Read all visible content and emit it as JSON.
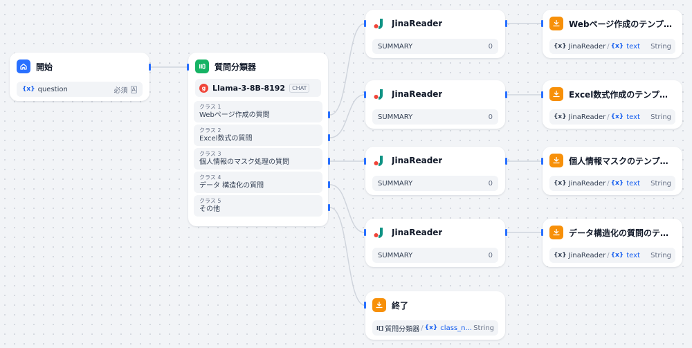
{
  "start": {
    "title": "開始",
    "var_name": "question",
    "var_required": "必須",
    "var_type_glyph": "A"
  },
  "classifier": {
    "title": "質問分類器",
    "model": "Llama-3-8B-8192",
    "model_tag": "CHAT",
    "classes": [
      {
        "label": "クラス 1",
        "text": "Webページ作成の質問"
      },
      {
        "label": "クラス 2",
        "text": "Excel数式の質問"
      },
      {
        "label": "クラス 3",
        "text": "個人情報のマスク処理の質問"
      },
      {
        "label": "クラス 4",
        "text": "データ 構造化の質問"
      },
      {
        "label": "クラス 5",
        "text": "その他"
      }
    ]
  },
  "readers": [
    {
      "title": "JinaReader",
      "field": "SUMMARY",
      "value": "0"
    },
    {
      "title": "JinaReader",
      "field": "SUMMARY",
      "value": "0"
    },
    {
      "title": "JinaReader",
      "field": "SUMMARY",
      "value": "0"
    },
    {
      "title": "JinaReader",
      "field": "SUMMARY",
      "value": "0"
    }
  ],
  "outputs": [
    {
      "title": "Webページ作成のテンプレートを...",
      "source": "JinaReader",
      "var": "text",
      "type": "String"
    },
    {
      "title": "Excel数式作成のテンプレートを...",
      "source": "JinaReader",
      "var": "text",
      "type": "String"
    },
    {
      "title": "個人情報マスクのテンプレートを...",
      "source": "JinaReader",
      "var": "text",
      "type": "String"
    },
    {
      "title": "データ構造化の質問のテンプレー...",
      "source": "JinaReader",
      "var": "text",
      "type": "String"
    }
  ],
  "end": {
    "title": "終了",
    "source": "質問分類器",
    "var": "class_n...",
    "type": "String"
  },
  "colors": {
    "start_icon": "#2970ff",
    "classifier_icon": "#16b364",
    "end_icon": "#f79009",
    "edge": "#d0d5dd",
    "handle": "#2970ff"
  }
}
